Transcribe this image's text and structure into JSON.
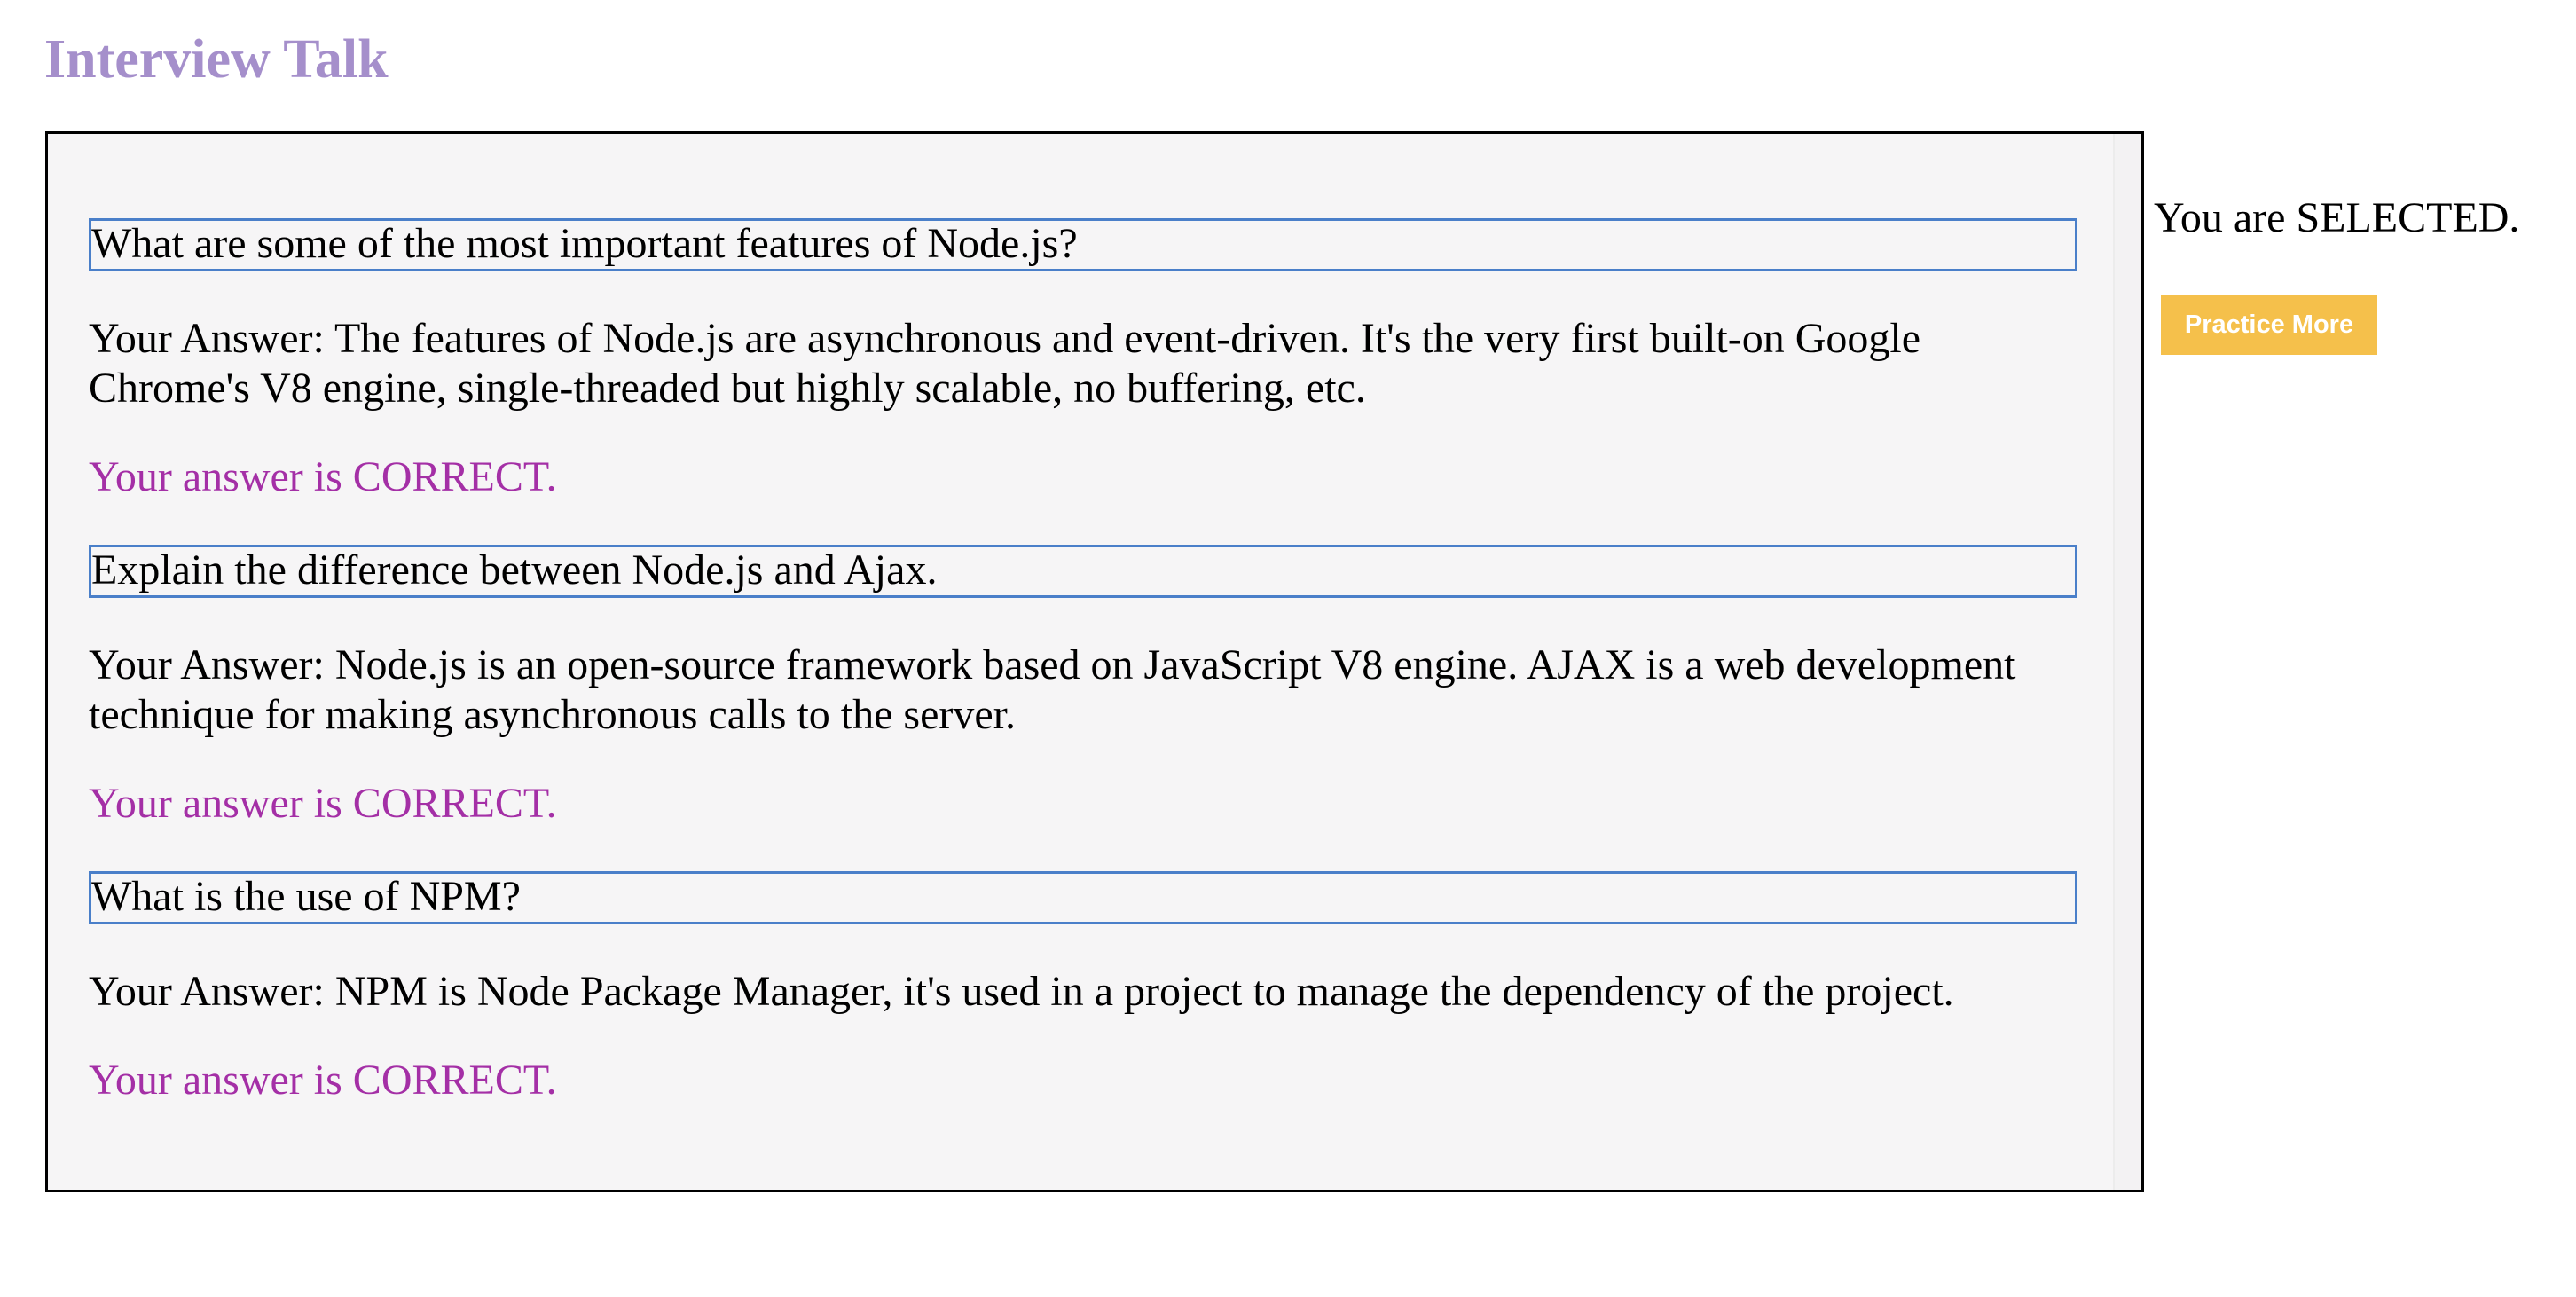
{
  "header": {
    "title": "Interview Talk"
  },
  "qa": [
    {
      "question": "What are some of the most important features of Node.js?",
      "answer": "Your Answer: The features of Node.js are asynchronous and event-driven. It's the very first built-on Google Chrome's V8 engine, single-threaded but highly scalable, no buffering, etc.",
      "verdict": "Your answer is CORRECT."
    },
    {
      "question": "Explain the difference between Node.js and Ajax.",
      "answer": "Your Answer: Node.js is an open-source framework based on JavaScript V8 engine. AJAX is a web development technique for making asynchronous calls to the server.",
      "verdict": "Your answer is CORRECT."
    },
    {
      "question": "What is the use of NPM?",
      "answer": "Your Answer: NPM is Node Package Manager, it's used in a project to manage the dependency of the project.",
      "verdict": "Your answer is CORRECT."
    }
  ],
  "sidebar": {
    "status": "You are SELECTED.",
    "practice_label": "Practice More"
  },
  "colors": {
    "title": "#a58fcb",
    "verdict": "#a42fa6",
    "question_border": "#4a7fc9",
    "button": "#f5c04b",
    "panel_bg": "#f6f5f6"
  }
}
